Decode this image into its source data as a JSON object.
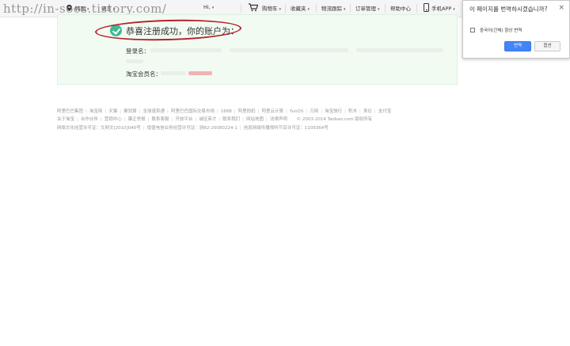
{
  "watermark": "http://in-soos.tistory.com/",
  "topbar": {
    "location": "韩国",
    "language": "语言",
    "user": "Hi,",
    "cart": "购物车",
    "favorites": "收藏夹",
    "logistics": "物流跟踪",
    "orders": "订单管理",
    "help": "帮助中心",
    "mobile": "手机APP"
  },
  "success": {
    "message": "恭喜注册成功，你的账户为：",
    "login_label": "登录名：",
    "member_label": "淘宝会员名："
  },
  "footer": {
    "row1": [
      "阿里巴巴集团",
      "淘宝网",
      "天猫",
      "聚划算",
      "全球速卖通",
      "阿里巴巴国际交易市场",
      "1688",
      "阿里妈妈",
      "阿里云计算",
      "YunOS",
      "万网",
      "淘宝旅行",
      "积木",
      "来往",
      "支付宝"
    ],
    "row2": [
      "关于淘宝",
      "合作伙伴",
      "营销中心",
      "廉正举报",
      "联系客服",
      "开放平台",
      "诚征英才",
      "联系我们",
      "网站地图",
      "法律声明"
    ],
    "copyright": "© 2003-2014 Taobao.com 版权所有",
    "row3": [
      "网络文化经营许可证：文网文[2010]040号",
      "增值电信业务经营许可证：浙B2-20080224-1",
      "信息网络传播视听节目许可证：1109364号"
    ]
  },
  "translate_popup": {
    "title": "이 페이지를 번역하시겠습니까?",
    "checkbox_label": "중국어(간체) 항상 번역",
    "translate_button": "번역",
    "options_button": "옵션"
  },
  "colors": {
    "success_bg": "#f2fbf2",
    "check": "#3cba92",
    "annotation": "#b3222c",
    "primary_button": "#4285f4"
  }
}
